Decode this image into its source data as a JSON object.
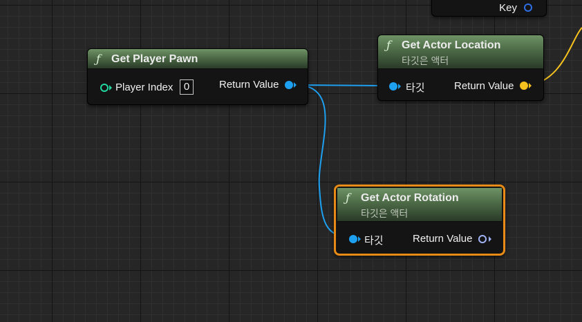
{
  "nodes": {
    "partial": {
      "pin_label": "Key"
    },
    "get_player_pawn": {
      "title": "Get Player Pawn",
      "fn_icon": "ƒ",
      "input_label": "Player Index",
      "input_value": "0",
      "output_label": "Return Value"
    },
    "get_actor_location": {
      "title": "Get Actor Location",
      "subtitle": "타깃은 액터",
      "fn_icon": "ƒ",
      "input_label": "타깃",
      "output_label": "Return Value"
    },
    "get_actor_rotation": {
      "title": "Get Actor Rotation",
      "subtitle": "타깃은 액터",
      "fn_icon": "ƒ",
      "input_label": "타깃",
      "output_label": "Return Value",
      "selected": true
    }
  },
  "colors": {
    "object_pin": "#1ea0f0",
    "vector_pin": "#f5c11e",
    "rotator_pin": "#9fb2f5",
    "int_pin": "#20d8a0",
    "selection": "#e88a16"
  }
}
